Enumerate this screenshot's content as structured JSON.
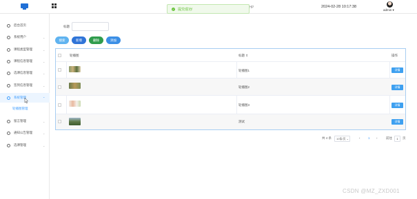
{
  "header": {
    "toast": "提交成功!",
    "php_text": "PHP",
    "datetime": "2024-02-28 10:17:38",
    "username": "admin"
  },
  "sidebar": {
    "items": [
      {
        "label": "后台首页",
        "icon": "home-icon"
      },
      {
        "label": "系统用户",
        "icon": "user-icon"
      },
      {
        "label": "课程类型管理",
        "icon": "book-icon"
      },
      {
        "label": "课程信息管理",
        "icon": "book-icon"
      },
      {
        "label": "选课信息管理",
        "icon": "book-icon"
      },
      {
        "label": "签到信息管理",
        "icon": "book-icon"
      },
      {
        "label": "系统管理",
        "icon": "folder-icon"
      },
      {
        "label": "留言管理",
        "icon": "chat-icon"
      },
      {
        "label": "通知公告管理",
        "icon": "bell-icon"
      },
      {
        "label": "选课管理",
        "icon": "grid-icon"
      }
    ],
    "active_sub": "轮播图管理"
  },
  "search": {
    "label": "标题",
    "value": ""
  },
  "toolbar": {
    "search": "搜索",
    "add": "新增",
    "delete": "删除",
    "extra": "添加"
  },
  "table": {
    "headers": {
      "image": "轮播图",
      "title": "标题 ⇕",
      "action": "操作"
    },
    "rows": [
      {
        "title": "轮播图1",
        "action": "详情"
      },
      {
        "title": "轮播图2",
        "action": "详情"
      },
      {
        "title": "轮播图3",
        "action": "详情"
      },
      {
        "title": "测试",
        "action": "详情"
      }
    ]
  },
  "pagination": {
    "total": "共 4 条",
    "page_size": "10条/页",
    "prev": "‹",
    "current": "1",
    "next": "›",
    "goto": "前往",
    "goto_value": "1",
    "page_unit": "页"
  },
  "watermark": "CSDN @MZ_ZXD001",
  "colors": {
    "accent": "#409eff",
    "success": "#67c23a"
  }
}
